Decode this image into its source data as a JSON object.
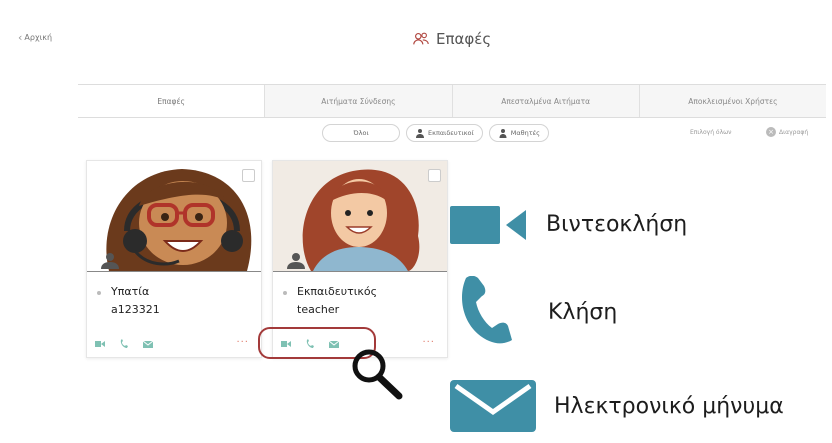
{
  "header": {
    "back_label": "Αρχική",
    "title": "Επαφές"
  },
  "tabs": [
    {
      "label": "Επαφές"
    },
    {
      "label": "Αιτήματα Σύνδεσης"
    },
    {
      "label": "Απεσταλμένα Αιτήματα"
    },
    {
      "label": "Αποκλεισμένοι Χρήστες"
    }
  ],
  "filters": {
    "all": "Όλοι",
    "teachers": "Εκπαιδευτικοί",
    "students": "Μαθητές"
  },
  "toolbar": {
    "select_all": "Επιλογή όλων",
    "delete": "Διαγραφή"
  },
  "contacts": [
    {
      "name": "Υπατία",
      "username": "a123321"
    },
    {
      "name": "Εκπαιδευτικός",
      "username": "teacher"
    }
  ],
  "legend": {
    "video_call": "Βιντεοκλήση",
    "call": "Κλήση",
    "email": "Ηλεκτρονικό μήνυμα"
  },
  "colors": {
    "accent_teal": "#3f8fa6",
    "highlight_red": "#a33a3a"
  }
}
